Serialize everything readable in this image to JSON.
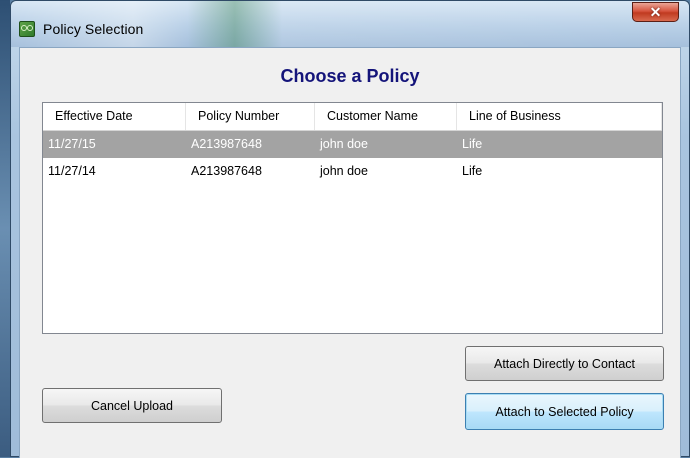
{
  "window": {
    "title": "Policy Selection",
    "close_glyph": "✕"
  },
  "heading": "Choose a Policy",
  "table": {
    "columns": [
      "Effective Date",
      "Policy Number",
      "Customer Name",
      "Line of Business"
    ],
    "rows": [
      {
        "effective_date": "11/27/15",
        "policy_number": "A213987648",
        "customer_name": "john doe",
        "line_of_business": "Life",
        "selected": true
      },
      {
        "effective_date": "11/27/14",
        "policy_number": "A213987648",
        "customer_name": "john doe",
        "line_of_business": "Life",
        "selected": false
      }
    ]
  },
  "buttons": {
    "attach_contact": "Attach Directly to Contact",
    "cancel": "Cancel Upload",
    "attach_policy": "Attach to Selected Policy"
  },
  "icons": {
    "app": "app-icon",
    "close": "close-icon"
  },
  "colors": {
    "heading": "#14147a",
    "selected_row": "#a3a3a3",
    "close_button": "#c03a20"
  }
}
